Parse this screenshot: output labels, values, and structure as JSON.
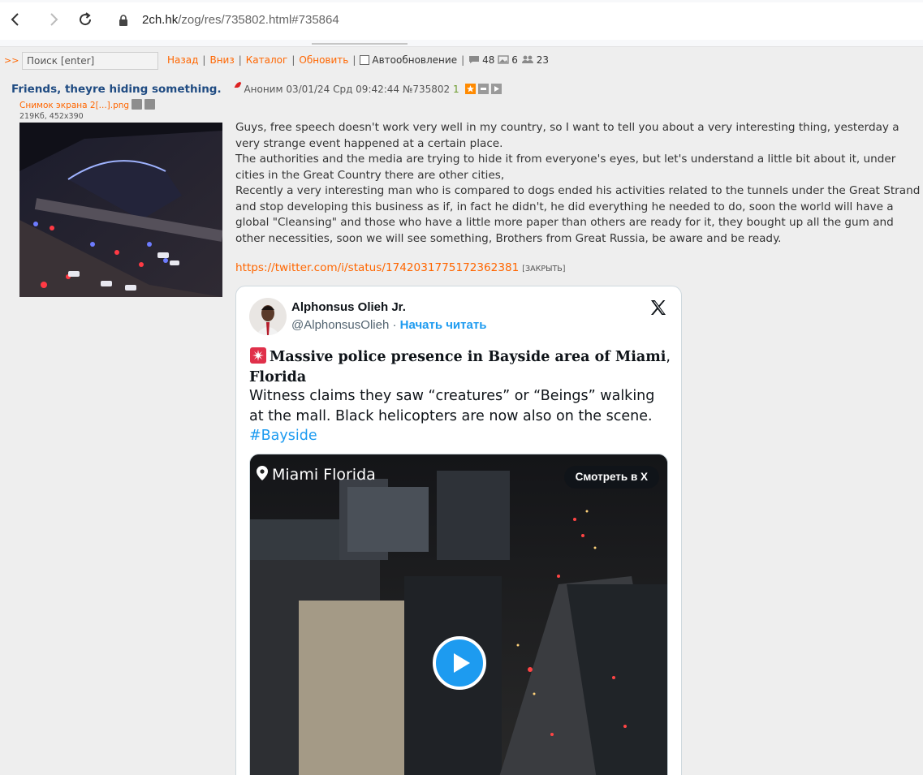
{
  "browser": {
    "url_domain": "2ch.hk",
    "url_path": "/zog/res/735802.html#735864"
  },
  "board_bar": {
    "arrow": ">>",
    "search_placeholder": "Поиск [enter]",
    "links": [
      "Назад",
      "Вниз",
      "Каталог",
      "Обновить"
    ],
    "autoupdate_label": "Автообновление",
    "posts_count": "48",
    "images_count": "6",
    "posters_count": "23"
  },
  "post": {
    "title": "Friends, theyre hiding something.",
    "author": "Аноним",
    "date": "03/01/24 Срд 09:42:44",
    "number": "№735802",
    "reply_count": "1",
    "file_name": "Снимок экрана 2[...].png",
    "file_meta": "219Кб, 452x390",
    "body": [
      "Guys, free speech doesn't work very well in my country, so I want to tell you about a very interesting thing, yesterday a very strange event happened at a certain place.",
      "The authorities and the media are trying to hide it from everyone's eyes, but let's understand a little bit about it, under cities in the Great Country there are other cities,",
      "Recently a very interesting man who is compared to dogs ended his activities related to the tunnels under the Great Strand and stop developing this business as if, in fact he didn't, he did everything he needed to do, soon the world will have a global \"Cleansing\" and those who have a little more paper than others are ready for it, they bought up all the gum and other necessities, soon we will see something, Brothers from Great Russia, be aware and be ready."
    ],
    "link": "https://twitter.com/i/status/1742031775172362381",
    "close_label": "[ЗАКРЫТЬ]"
  },
  "tweet": {
    "author_name": "Alphonsus Olieh Jr.",
    "handle": "@AlphonsusOlieh",
    "handle_sep": " · ",
    "follow_label": "Начать читать",
    "headline_main": "Massive police presence in Bayside area of Miami",
    "headline_comma": ",",
    "headline_end": "Florida",
    "text": "Witness claims they saw “creatures” or “Beings” walking at the mall. Black helicopters are now also on the scene.",
    "hashtag": "#Bayside",
    "video_location": "Miami Florida",
    "watch_label": "Смотреть в X"
  },
  "colors": {
    "link_orange": "#ff6600",
    "title_blue": "#1f4b82",
    "twitter_blue": "#1d9bf0"
  }
}
